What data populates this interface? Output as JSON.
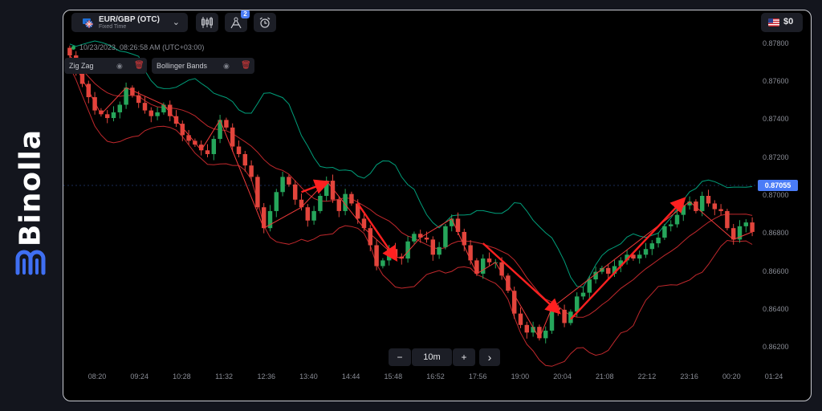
{
  "brand": {
    "name": "Binolla"
  },
  "asset": {
    "name": "EUR/GBP (OTC)",
    "type": "Fixed Time",
    "chevron_icon": "chevron-down-icon"
  },
  "toolbar": {
    "drawings_badge": "2"
  },
  "balance": {
    "amount": "$0"
  },
  "clock": {
    "text": "10/23/2023, 08:26:58 AM  (UTC+03:00)"
  },
  "indicators": [
    {
      "label": "Zig Zag"
    },
    {
      "label": "Bollinger Bands"
    }
  ],
  "timeframe": {
    "label": "10m",
    "minus": "−",
    "plus": "+",
    "next": "›"
  },
  "colors": {
    "up": "#26a65b",
    "down": "#e2453c",
    "accent": "#4a7cf7",
    "band_mid": "#009e7a",
    "band": "#c0282c"
  },
  "chart_data": {
    "type": "candlestick",
    "y_ticks": [
      "0.87800",
      "0.87600",
      "0.87400",
      "0.87200",
      "0.87000",
      "0.86800",
      "0.86600",
      "0.86400",
      "0.86200"
    ],
    "x_ticks": [
      "08:20",
      "09:24",
      "10:28",
      "11:32",
      "12:36",
      "13:40",
      "14:44",
      "15:48",
      "16:52",
      "17:56",
      "19:00",
      "20:04",
      "21:08",
      "22:12",
      "23:16",
      "00:20",
      "01:24"
    ],
    "current_price": "0.87055",
    "ylim": [
      0.8615,
      0.8785
    ],
    "series_closes": [
      0.8774,
      0.8766,
      0.8759,
      0.8752,
      0.8745,
      0.8743,
      0.8741,
      0.8744,
      0.8748,
      0.8757,
      0.8753,
      0.8749,
      0.8745,
      0.8742,
      0.8744,
      0.8748,
      0.8742,
      0.8738,
      0.8732,
      0.8729,
      0.8727,
      0.8724,
      0.8722,
      0.873,
      0.874,
      0.8736,
      0.8726,
      0.8722,
      0.8716,
      0.871,
      0.8694,
      0.8683,
      0.8692,
      0.8702,
      0.871,
      0.8706,
      0.8698,
      0.8694,
      0.8687,
      0.8692,
      0.87,
      0.8708,
      0.8698,
      0.8692,
      0.8701,
      0.8696,
      0.8688,
      0.8683,
      0.8674,
      0.8663,
      0.8666,
      0.8672,
      0.8668,
      0.8667,
      0.8676,
      0.868,
      0.8678,
      0.8677,
      0.8669,
      0.8673,
      0.8684,
      0.8688,
      0.8681,
      0.8674,
      0.8666,
      0.8659,
      0.8667,
      0.8665,
      0.8665,
      0.8658,
      0.865,
      0.8638,
      0.8632,
      0.8628,
      0.8631,
      0.8625,
      0.8629,
      0.8641,
      0.864,
      0.8633,
      0.8639,
      0.8647,
      0.8649,
      0.8656,
      0.866,
      0.8662,
      0.8659,
      0.8663,
      0.8666,
      0.8669,
      0.8667,
      0.8669,
      0.8672,
      0.8675,
      0.8678,
      0.8684,
      0.8685,
      0.869,
      0.8695,
      0.8697,
      0.8692,
      0.87,
      0.8696,
      0.8693,
      0.8692,
      0.8683,
      0.8677,
      0.8684,
      0.8686,
      0.8681
    ]
  }
}
